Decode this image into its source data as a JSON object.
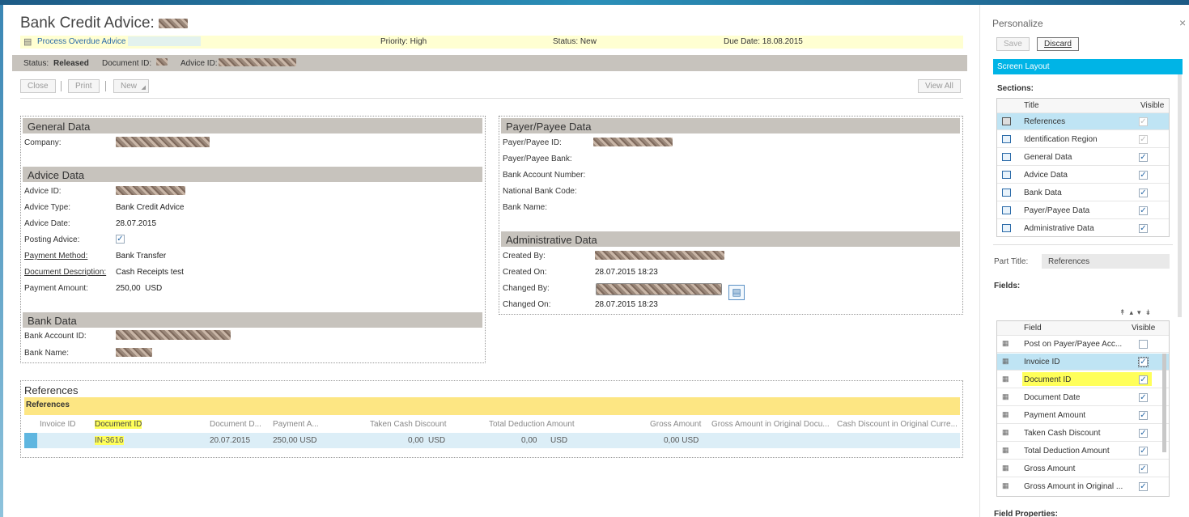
{
  "page": {
    "title": "Bank Credit Advice:"
  },
  "task": {
    "link": "Process Overdue Advice",
    "priority": "Priority: High",
    "status": "Status: New",
    "due": "Due Date: 18.08.2015"
  },
  "statusbar": {
    "status_label": "Status:",
    "status_value": "Released",
    "docid_label": "Document ID:",
    "adviceid_label": "Advice ID:"
  },
  "toolbar": {
    "close": "Close",
    "print": "Print",
    "new": "New",
    "view_all": "View All"
  },
  "general": {
    "title": "General Data",
    "company_label": "Company:"
  },
  "advice": {
    "title": "Advice Data",
    "advice_id_label": "Advice ID:",
    "type_label": "Advice Type:",
    "type_value": "Bank Credit Advice",
    "date_label": "Advice Date:",
    "date_value": "28.07.2015",
    "posting_label": "Posting Advice:",
    "posting_checked": "✓",
    "method_label": "Payment Method:",
    "method_value": "Bank Transfer",
    "desc_label": "Document Description:",
    "desc_value": "Cash Receipts test",
    "amount_label": "Payment Amount:",
    "amount_value": "250,00  USD"
  },
  "bank": {
    "title": "Bank Data",
    "account_label": "Bank Account ID:",
    "name_label": "Bank Name:"
  },
  "payer": {
    "title": "Payer/Payee Data",
    "id_label": "Payer/Payee ID:",
    "bank_label": "Payer/Payee Bank:",
    "account_label": "Bank Account Number:",
    "code_label": "National Bank Code:",
    "name_label": "Bank Name:"
  },
  "admin": {
    "title": "Administrative Data",
    "created_by": "Created By:",
    "created_on": "Created On:",
    "created_on_value": "28.07.2015 18:23",
    "changed_by": "Changed By:",
    "changed_on": "Changed On:",
    "changed_on_value": "28.07.2015 18:23"
  },
  "references": {
    "title": "References",
    "bar": "References",
    "columns": [
      "Invoice ID",
      "Document ID",
      "Document D...",
      "Payment A...",
      "Taken Cash Discount",
      "Total Deduction Amount",
      "Gross Amount",
      "Gross Amount in Original Docu...",
      "Cash Discount in Original Curre..."
    ],
    "row": {
      "invoice": "",
      "document": "IN-3616",
      "date": "20.07.2015",
      "payment": "250,00 USD",
      "taken": "0,00  USD",
      "deduction": "0,00",
      "deduction_cur": "USD",
      "gross": "0,00 USD"
    }
  },
  "personalize": {
    "title": "Personalize",
    "close": "×",
    "save": "Save",
    "discard": "Discard",
    "screen_layout": "Screen Layout",
    "sections_label": "Sections:",
    "sections_header": {
      "title": "Title",
      "visible": "Visible"
    },
    "sections": [
      {
        "title": "References",
        "visible": "✓"
      },
      {
        "title": "Identification Region",
        "visible": "✓"
      },
      {
        "title": "General Data",
        "visible": "✓"
      },
      {
        "title": "Advice Data",
        "visible": "✓"
      },
      {
        "title": "Bank Data",
        "visible": "✓"
      },
      {
        "title": "Payer/Payee Data",
        "visible": "✓"
      },
      {
        "title": "Administrative Data",
        "visible": "✓"
      }
    ],
    "part_title_label": "Part Title:",
    "part_title_value": "References",
    "fields_label": "Fields:",
    "fields_header": {
      "field": "Field",
      "visible": "Visible"
    },
    "fields": [
      {
        "name": "Post on Payer/Payee Acc...",
        "visible": ""
      },
      {
        "name": "Invoice ID",
        "visible": "✓"
      },
      {
        "name": "Document ID",
        "visible": "✓"
      },
      {
        "name": "Document Date",
        "visible": "✓"
      },
      {
        "name": "Payment Amount",
        "visible": "✓"
      },
      {
        "name": "Taken Cash Discount",
        "visible": "✓"
      },
      {
        "name": "Total Deduction Amount",
        "visible": "✓"
      },
      {
        "name": "Gross Amount",
        "visible": "✓"
      },
      {
        "name": "Gross Amount in Original ...",
        "visible": "✓"
      }
    ],
    "field_properties_label": "Field Properties:"
  },
  "colors": {
    "accent": "#00b4e6",
    "highlight": "#ffff5a",
    "refbar": "#fde683",
    "section_header": "#c7c3bd"
  }
}
